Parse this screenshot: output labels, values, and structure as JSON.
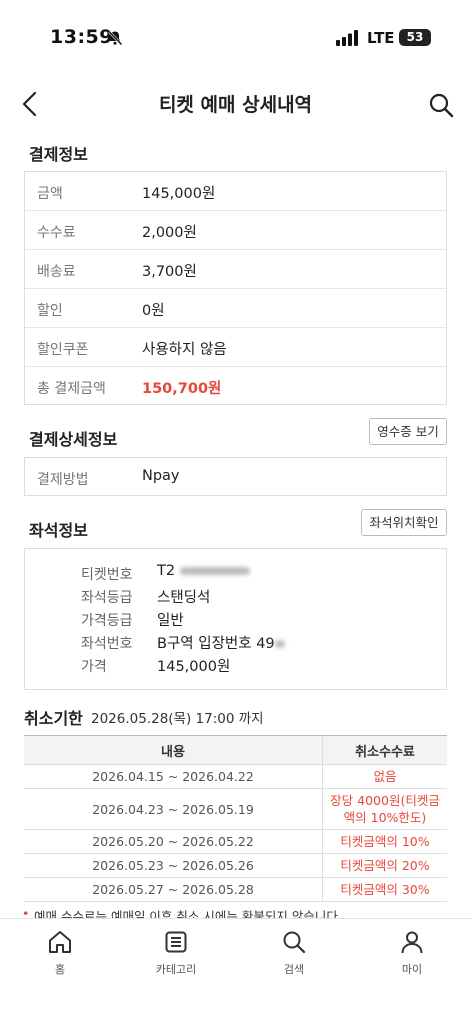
{
  "status_bar": {
    "time": "13:59",
    "network": "LTE",
    "battery": "53"
  },
  "header": {
    "title": "티켓 예매 상세내역"
  },
  "payment": {
    "section_title": "결제정보",
    "rows": [
      {
        "label": "금액",
        "value": "145,000원"
      },
      {
        "label": "수수료",
        "value": "2,000원"
      },
      {
        "label": "배송료",
        "value": "3,700원"
      },
      {
        "label": "할인",
        "value": "0원"
      },
      {
        "label": "할인쿠폰",
        "value": "사용하지 않음"
      },
      {
        "label": "총 결제금액",
        "value": "150,700원"
      }
    ]
  },
  "payment_detail": {
    "section_title": "결제상세정보",
    "receipt_button": "영수증 보기",
    "method_label": "결제방법",
    "method_value": "Npay"
  },
  "seat": {
    "section_title": "좌석정보",
    "location_button": "좌석위치확인",
    "rows": [
      {
        "label": "티켓번호",
        "value": "T2"
      },
      {
        "label": "좌석등급",
        "value": "스탠딩석"
      },
      {
        "label": "가격등급",
        "value": "일반"
      },
      {
        "label": "좌석번호",
        "value": "B구역 입장번호 49"
      },
      {
        "label": "가격",
        "value": "145,000원"
      }
    ]
  },
  "cancel": {
    "title": "취소기한",
    "deadline": "2026.05.28(목) 17:00 까지",
    "headers": [
      "내용",
      "취소수수료"
    ],
    "rows": [
      {
        "period": "2026.04.15 ~ 2026.04.22",
        "fee": "없음"
      },
      {
        "period": "2026.04.23 ~ 2026.05.19",
        "fee": "장당 4000원(티켓금액의 10%한도)"
      },
      {
        "period": "2026.05.20 ~ 2026.05.22",
        "fee": "티켓금액의 10%"
      },
      {
        "period": "2026.05.23 ~ 2026.05.26",
        "fee": "티켓금액의 20%"
      },
      {
        "period": "2026.05.27 ~ 2026.05.28",
        "fee": "티켓금액의 30%"
      }
    ],
    "note": "예매 수수료는 예매일 이후 취소 시에는 환불되지 않습니다"
  },
  "nav": [
    {
      "label": "홈",
      "icon": "home-icon"
    },
    {
      "label": "카테고리",
      "icon": "list-icon"
    },
    {
      "label": "검색",
      "icon": "search-icon"
    },
    {
      "label": "마이",
      "icon": "person-icon"
    }
  ],
  "colors": {
    "accent": "#e8483b"
  }
}
